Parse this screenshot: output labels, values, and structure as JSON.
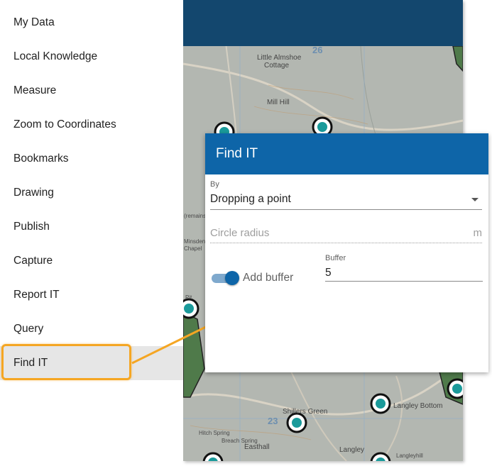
{
  "sidebar": {
    "items": [
      {
        "label": "My Data"
      },
      {
        "label": "Local Knowledge"
      },
      {
        "label": "Measure"
      },
      {
        "label": "Zoom to Coordinates"
      },
      {
        "label": "Bookmarks"
      },
      {
        "label": "Drawing"
      },
      {
        "label": "Publish"
      },
      {
        "label": "Capture"
      },
      {
        "label": "Report IT"
      },
      {
        "label": "Query"
      },
      {
        "label": "Find IT"
      }
    ],
    "active": "Find IT"
  },
  "panel": {
    "title": "Find IT",
    "by_label": "By",
    "by_value": "Dropping a point",
    "radius_placeholder": "Circle radius",
    "radius_unit": "m",
    "add_buffer_label": "Add buffer",
    "add_buffer_on": true,
    "buffer_label": "Buffer",
    "buffer_value": "5"
  },
  "map": {
    "labels": {
      "little_almshoe": "Little Almshoe",
      "cottage": "Cottage",
      "mill_hill": "Mill Hill",
      "grid_26": "26",
      "grid_23": "23",
      "langley_bottom": "Langley Bottom",
      "shillers_green": "Shillers Green",
      "hitch_spring": "Hitch Spring",
      "breach_spring": "Breach Spring",
      "easthall": "Easthall",
      "langley": "Langley",
      "langleyhill": "Langleyhill",
      "pit": "Pit",
      "minsden": "Minsden",
      "chapel": "Chapel",
      "remains": "(remains of)"
    }
  },
  "colors": {
    "header_bar": "#13476e",
    "panel_header": "#0e65a8",
    "highlight": "#f5a623",
    "marker_fill": "#1a9a9a"
  }
}
